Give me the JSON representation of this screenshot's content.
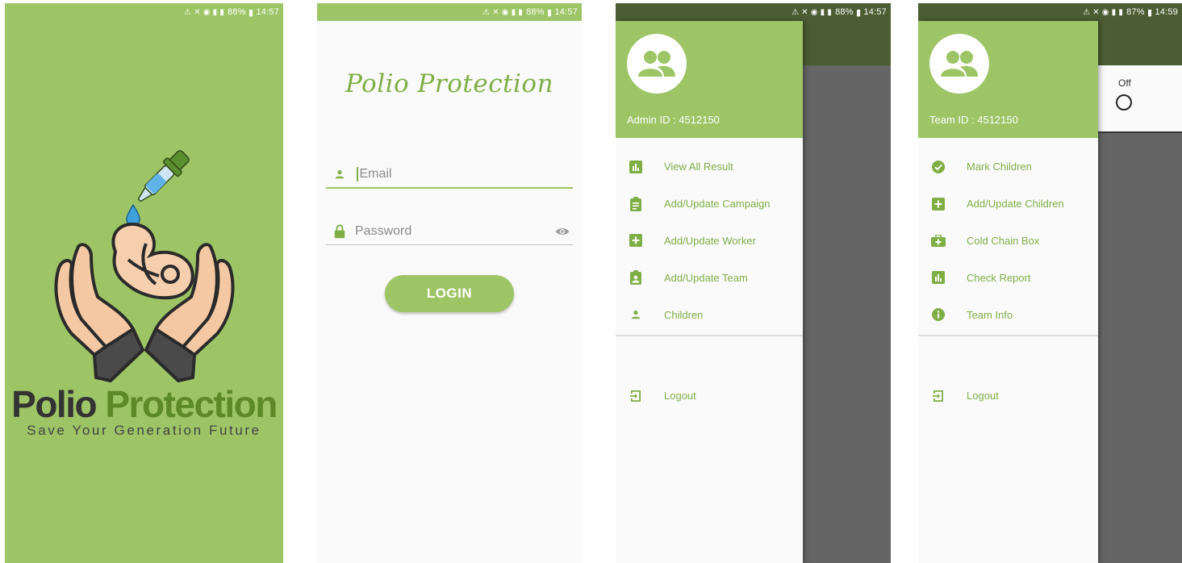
{
  "colors": {
    "brand": "#9dc566",
    "brand_dark": "#4b5d32",
    "text_accent": "#7fae45",
    "scrim": "#656565"
  },
  "splash": {
    "status": {
      "battery": "88%",
      "time": "14:57"
    },
    "brand_part1": "Polio",
    "brand_part2": "Protection",
    "tagline": "Save Your Generation Future"
  },
  "login": {
    "status": {
      "battery": "88%",
      "time": "14:57"
    },
    "title": "Polio Protection",
    "email_placeholder": "Email",
    "password_placeholder": "Password",
    "login_label": "LOGIN"
  },
  "admin_drawer": {
    "status": {
      "battery": "88%",
      "time": "14:57"
    },
    "id_label": "Admin ID : 4512150",
    "items": [
      {
        "label": "View All Result",
        "icon": "chart-icon"
      },
      {
        "label": "Add/Update Campaign",
        "icon": "clipboard-list-icon"
      },
      {
        "label": "Add/Update Worker",
        "icon": "plus-box-icon"
      },
      {
        "label": "Add/Update Team",
        "icon": "clipboard-user-icon"
      },
      {
        "label": "Children",
        "icon": "person-icon"
      }
    ],
    "logout_label": "Logout"
  },
  "team_drawer": {
    "status": {
      "battery": "87%",
      "time": "14:59"
    },
    "id_label": "Team ID : 4512150",
    "items": [
      {
        "label": "Mark Children",
        "icon": "check-circle-icon"
      },
      {
        "label": "Add/Update Children",
        "icon": "plus-box-icon"
      },
      {
        "label": "Cold Chain Box",
        "icon": "medical-bag-icon"
      },
      {
        "label": "Check Report",
        "icon": "chart-icon"
      },
      {
        "label": "Team Info",
        "icon": "info-icon"
      }
    ],
    "logout_label": "Logout",
    "toggle_label": "Off"
  }
}
